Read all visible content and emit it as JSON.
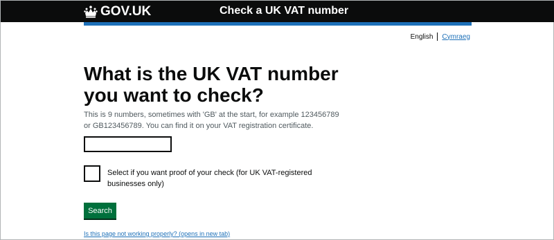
{
  "header": {
    "logo_text": "GOV.UK",
    "logo_icon": "crown-icon",
    "service_name": "Check a UK VAT number"
  },
  "language": {
    "current": "English",
    "alternate": "Cymraeg"
  },
  "main": {
    "heading": "What is the UK VAT number you want to check?",
    "hint": "This is 9 numbers, sometimes with 'GB' at the start, for example 123456789 or GB123456789. You can find it on your VAT registration certificate.",
    "vat_input_value": "",
    "checkbox_label": "Select if you want proof of your check (for UK VAT-registered businesses only)",
    "checkbox_checked": false,
    "search_label": "Search",
    "help_link": "Is this page not working properly? (opens in new tab)"
  },
  "colors": {
    "header_bg": "#0b0c0c",
    "accent_bar": "#1d70b8",
    "link": "#1d70b8",
    "button": "#00703c"
  }
}
